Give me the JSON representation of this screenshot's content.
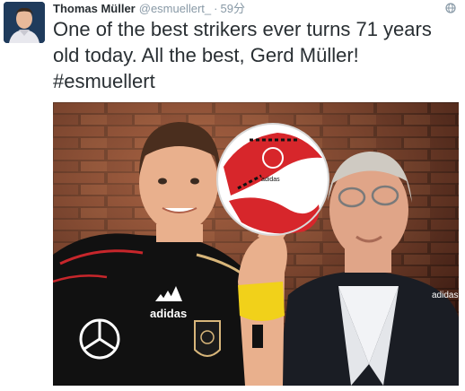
{
  "tweet": {
    "display_name": "Thomas Müller",
    "handle": "@esmuellert_",
    "separator": "·",
    "time": "59分",
    "text": "One of the best strikers ever turns 71 years old today. All the best, Gerd Müller!",
    "hashtag": "#esmuellert",
    "photo_alt": "",
    "icons": {
      "avatar": "avatar",
      "globe": "globe-icon"
    },
    "photo_texts": {
      "shirt_brand": "adidas",
      "ball_brand": "adidas",
      "suit_brand": "adidas"
    },
    "colors": {
      "text": "#292f33",
      "muted": "#8899a6",
      "ball_red": "#d7262b",
      "brick": "#6e3322",
      "jersey_black": "#111111"
    }
  }
}
